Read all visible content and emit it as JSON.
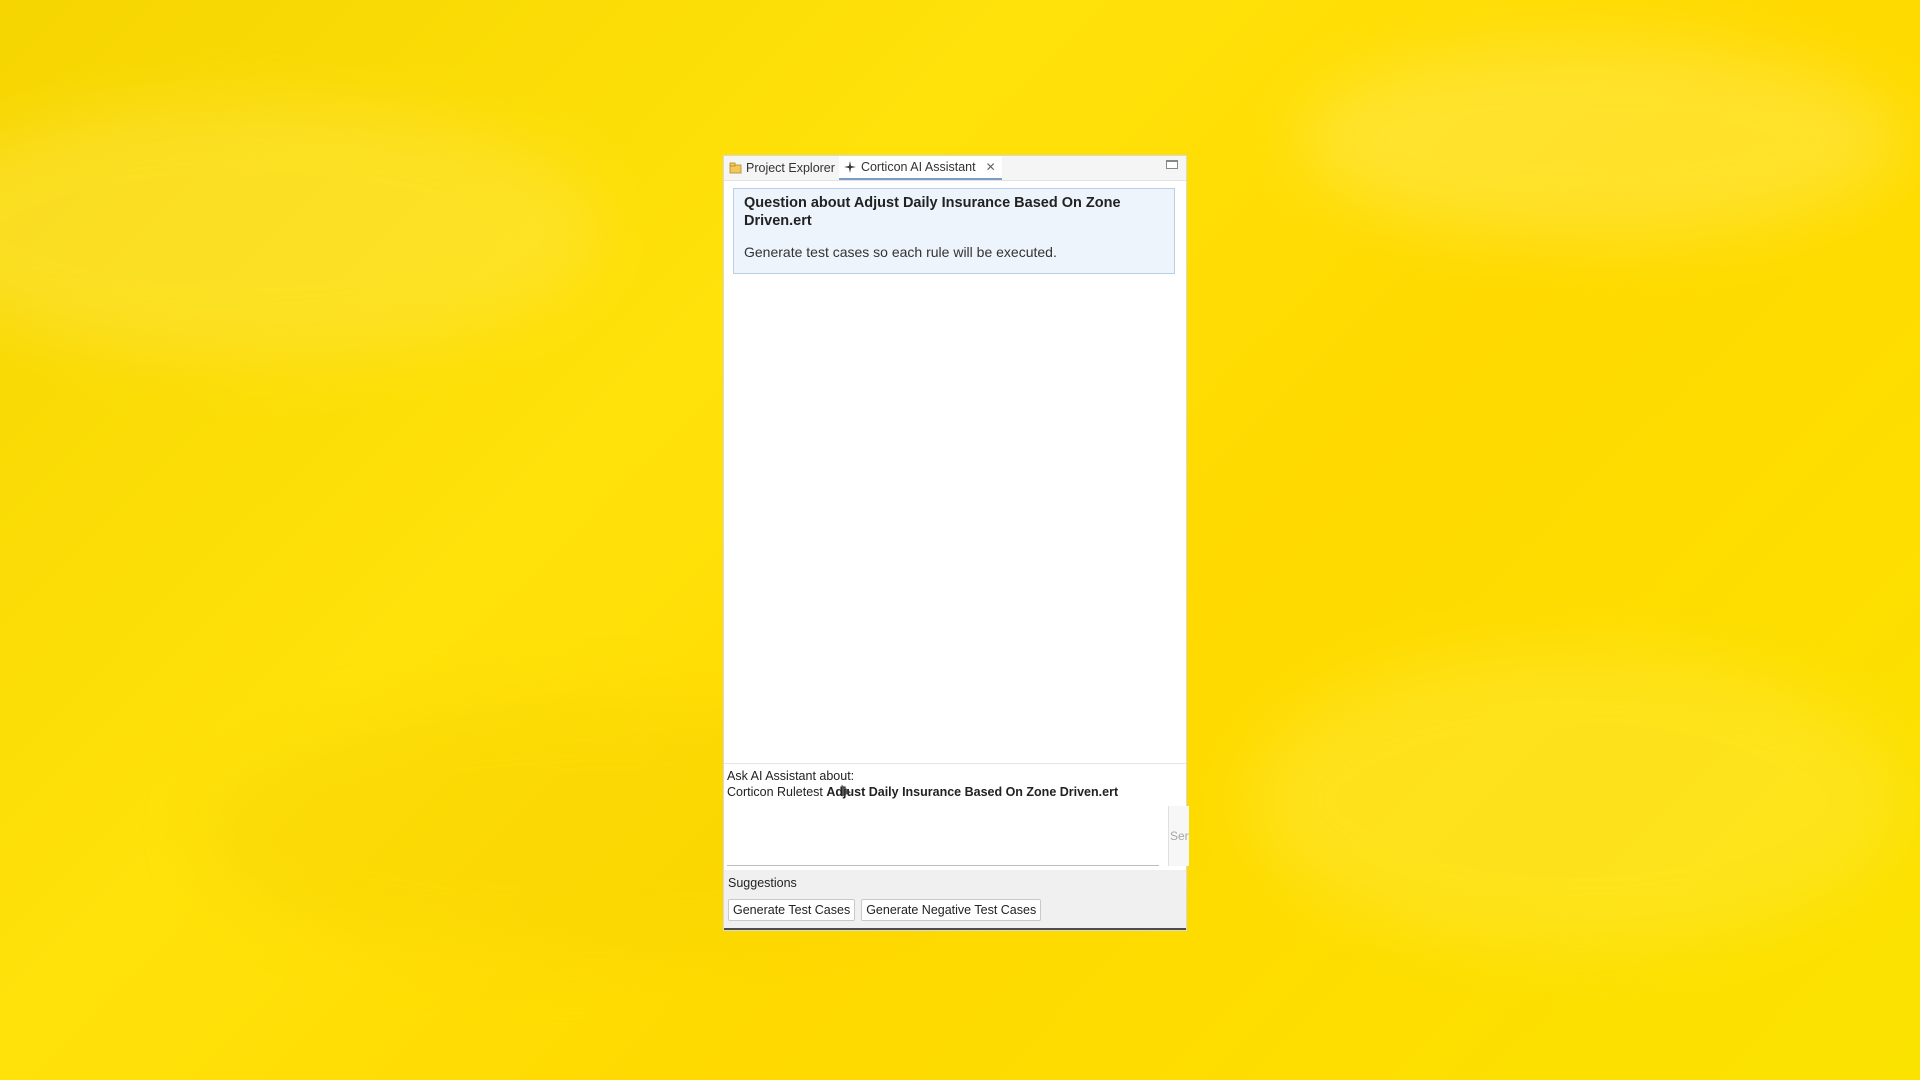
{
  "tabs": [
    {
      "label": "Project Explorer",
      "icon": "project-explorer-icon"
    },
    {
      "label": "Corticon AI Assistant",
      "icon": "sparkle-icon",
      "active": true
    }
  ],
  "question": {
    "title": "Question about Adjust Daily Insurance Based On Zone Driven.ert",
    "body": "Generate test cases so each rule will be executed."
  },
  "ask": {
    "label": "Ask AI Assistant about:",
    "context_prefix": "Corticon Ruletest",
    "context_name": "Adjust Daily Insurance Based On Zone Driven.ert"
  },
  "input": {
    "placeholder": "",
    "value": ""
  },
  "send_label": "Sen",
  "suggestions": {
    "label": "Suggestions",
    "items": [
      "Generate Test Cases",
      "Generate Negative Test Cases"
    ]
  },
  "colors": {
    "background": "#ffdf00",
    "card_bg": "#eef4fb",
    "card_border": "#b9cfe6",
    "active_tab_underline": "#7a9cc6"
  }
}
